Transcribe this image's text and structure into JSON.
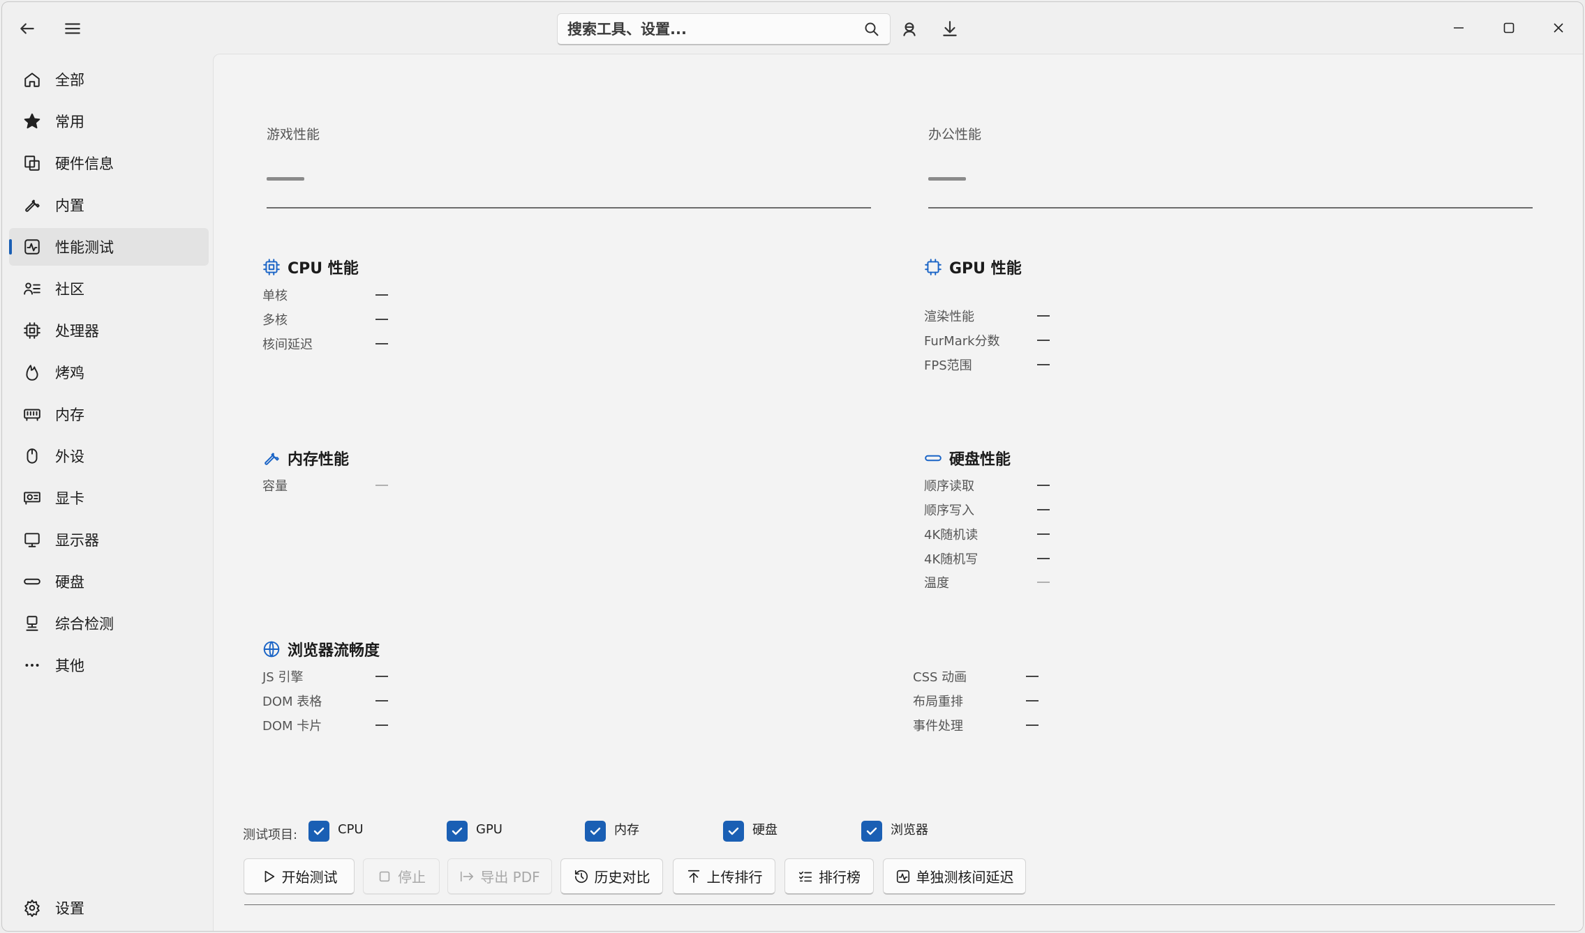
{
  "search": {
    "placeholder": "搜索工具、设置..."
  },
  "sidebar": {
    "items": [
      {
        "label": "全部",
        "icon": "home-icon"
      },
      {
        "label": "常用",
        "icon": "star-icon"
      },
      {
        "label": "硬件信息",
        "icon": "hardware-info-icon"
      },
      {
        "label": "内置",
        "icon": "wrench-icon"
      },
      {
        "label": "性能测试",
        "icon": "benchmark-icon",
        "active": true
      },
      {
        "label": "社区",
        "icon": "community-icon"
      },
      {
        "label": "处理器",
        "icon": "cpu-icon"
      },
      {
        "label": "烤鸡",
        "icon": "flame-icon"
      },
      {
        "label": "内存",
        "icon": "memory-icon"
      },
      {
        "label": "外设",
        "icon": "mouse-icon"
      },
      {
        "label": "显卡",
        "icon": "gpu-card-icon"
      },
      {
        "label": "显示器",
        "icon": "monitor-icon"
      },
      {
        "label": "硬盘",
        "icon": "disk-icon"
      },
      {
        "label": "综合检测",
        "icon": "comprehensive-icon"
      },
      {
        "label": "其他",
        "icon": "more-icon"
      }
    ],
    "settings": {
      "label": "设置",
      "icon": "gear-icon"
    }
  },
  "main": {
    "game_perf": {
      "title": "游戏性能",
      "value": "—"
    },
    "office_perf": {
      "title": "办公性能",
      "value": "—"
    },
    "cpu": {
      "title": "CPU 性能",
      "metrics": [
        {
          "label": "单核",
          "value": "—"
        },
        {
          "label": "多核",
          "value": "—"
        },
        {
          "label": "核间延迟",
          "value": "—"
        }
      ]
    },
    "gpu": {
      "title": "GPU 性能",
      "metrics": [
        {
          "label": "渲染性能",
          "value": "—"
        },
        {
          "label": "FurMark分数",
          "value": "—"
        },
        {
          "label": "FPS范围",
          "value": "—"
        }
      ]
    },
    "memory": {
      "title": "内存性能",
      "metrics": [
        {
          "label": "容量",
          "value": "—"
        }
      ]
    },
    "disk": {
      "title": "硬盘性能",
      "metrics": [
        {
          "label": "顺序读取",
          "value": "—"
        },
        {
          "label": "顺序写入",
          "value": "—"
        },
        {
          "label": "4K随机读",
          "value": "—"
        },
        {
          "label": "4K随机写",
          "value": "—"
        },
        {
          "label": "温度",
          "value": "—"
        }
      ]
    },
    "browser": {
      "title": "浏览器流畅度",
      "metrics": [
        {
          "label": "JS 引擎",
          "value": "—"
        },
        {
          "label": "DOM 表格",
          "value": "—"
        },
        {
          "label": "DOM 卡片",
          "value": "—"
        },
        {
          "label": "CSS 动画",
          "value": "—"
        },
        {
          "label": "布局重排",
          "value": "—"
        },
        {
          "label": "事件处理",
          "value": "—"
        }
      ]
    }
  },
  "tests": {
    "label": "测试项目:",
    "items": [
      {
        "label": "CPU",
        "checked": true
      },
      {
        "label": "GPU",
        "checked": true
      },
      {
        "label": "内存",
        "checked": true
      },
      {
        "label": "硬盘",
        "checked": true
      },
      {
        "label": "浏览器",
        "checked": true
      }
    ]
  },
  "buttons": {
    "start": "开始测试",
    "stop": "停止",
    "export": "导出 PDF",
    "history": "历史对比",
    "upload": "上传排行",
    "ranking": "排行榜",
    "core_latency": "单独测核间延迟"
  },
  "colors": {
    "accent": "#1a5fb4",
    "icon_accent": "#1a64c6"
  }
}
